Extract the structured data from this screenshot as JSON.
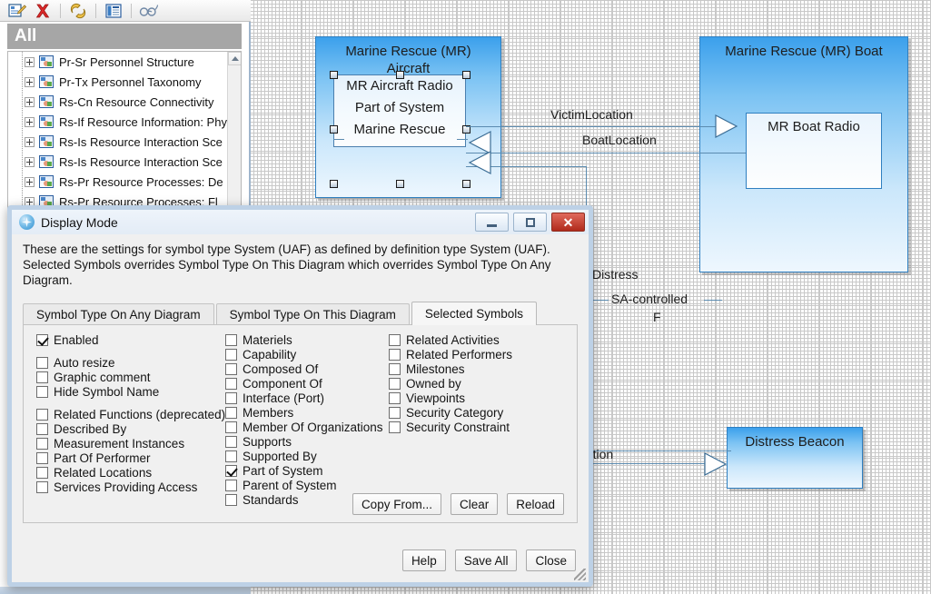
{
  "toolbar": {
    "buttons": [
      {
        "name": "edit-properties-icon",
        "glyph": "edit"
      },
      {
        "name": "delete-icon",
        "glyph": "delete"
      },
      {
        "name": "link-icon",
        "glyph": "link"
      },
      {
        "name": "report-icon",
        "glyph": "report"
      },
      {
        "name": "glasses-icon",
        "glyph": "glasses"
      }
    ]
  },
  "tree": {
    "header": "All",
    "items": [
      "Pr-Sr Personnel Structure",
      "Pr-Tx Personnel Taxonomy",
      "Rs-Cn Resource Connectivity",
      "Rs-If Resource Information: Phy",
      "Rs-Is Resource Interaction Sce",
      "Rs-Is Resource Interaction Sce",
      "Rs-Pr Resource Processes: De",
      "Rs-Pr Resource Processes: Fl"
    ]
  },
  "diagram": {
    "aircraft_block": {
      "title_line1": "Marine Rescue (MR)",
      "title_line2": "Aircraft",
      "selected_part": {
        "line1": "MR Aircraft Radio",
        "line2": "Part of System",
        "line3": "Marine Rescue"
      }
    },
    "boat_block": {
      "title": "Marine Rescue (MR) Boat",
      "inner_title": "MR Boat Radio"
    },
    "beacon_block": {
      "title": "Distress Beacon"
    },
    "edge_labels": {
      "victim_location": "VictimLocation",
      "boat_location": "BoatLocation",
      "distress": "Distress",
      "sa_controlled": "SA-controlled",
      "sa_controlled_sub": "F",
      "location_clipped": "ocation"
    }
  },
  "dialog": {
    "title": "Display Mode",
    "window_buttons": {
      "minimize": "minimize-button",
      "maximize": "maximize-button",
      "close": "close-button"
    },
    "description_line1": "These are the settings for symbol type System (UAF) as defined by definition type System (UAF).",
    "description_line2": "Selected Symbols overrides Symbol Type On This Diagram which overrides Symbol Type On Any Diagram.",
    "tabs": [
      {
        "label": "Symbol Type On Any Diagram",
        "active": false
      },
      {
        "label": "Symbol Type On This Diagram",
        "active": false
      },
      {
        "label": "Selected Symbols",
        "active": true
      }
    ],
    "column1": [
      {
        "label": "Enabled",
        "checked": true,
        "gap_after": true
      },
      {
        "label": "Auto resize",
        "checked": false
      },
      {
        "label": "Graphic comment",
        "checked": false
      },
      {
        "label": "Hide Symbol Name",
        "checked": false,
        "gap_after": true
      },
      {
        "label": "Related Functions (deprecated)",
        "checked": false
      },
      {
        "label": "Described By",
        "checked": false
      },
      {
        "label": "Measurement Instances",
        "checked": false
      },
      {
        "label": "Part Of Performer",
        "checked": false
      },
      {
        "label": "Related Locations",
        "checked": false
      },
      {
        "label": "Services Providing Access",
        "checked": false
      }
    ],
    "column2": [
      {
        "label": "Materiels",
        "checked": false
      },
      {
        "label": "Capability",
        "checked": false
      },
      {
        "label": "Composed Of",
        "checked": false
      },
      {
        "label": "Component Of",
        "checked": false
      },
      {
        "label": "Interface (Port)",
        "checked": false
      },
      {
        "label": "Members",
        "checked": false
      },
      {
        "label": "Member Of Organizations",
        "checked": false
      },
      {
        "label": "Supports",
        "checked": false
      },
      {
        "label": "Supported By",
        "checked": false
      },
      {
        "label": "Part of System",
        "checked": true
      },
      {
        "label": "Parent of System",
        "checked": false
      },
      {
        "label": "Standards",
        "checked": false
      }
    ],
    "column3": [
      {
        "label": "Related Activities",
        "checked": false
      },
      {
        "label": "Related Performers",
        "checked": false
      },
      {
        "label": "Milestones",
        "checked": false
      },
      {
        "label": "Owned by",
        "checked": false
      },
      {
        "label": "Viewpoints",
        "checked": false
      },
      {
        "label": "Security Category",
        "checked": false
      },
      {
        "label": "Security Constraint",
        "checked": false
      }
    ],
    "panel_buttons": [
      {
        "label": "Copy From...",
        "name": "copy-from-button"
      },
      {
        "label": "Clear",
        "name": "clear-button"
      },
      {
        "label": "Reload",
        "name": "reload-button"
      }
    ],
    "footer_buttons": [
      {
        "label": "Help",
        "name": "help-button"
      },
      {
        "label": "Save All",
        "name": "save-all-button"
      },
      {
        "label": "Close",
        "name": "close-dialog-button"
      }
    ]
  },
  "colors": {
    "block_fill_top": "#3ba0ec",
    "block_border": "#2f7fc0",
    "header_gray": "#a6a6a6",
    "dialog_border": "#bdd1e6",
    "close_red": "#b02a1b"
  }
}
